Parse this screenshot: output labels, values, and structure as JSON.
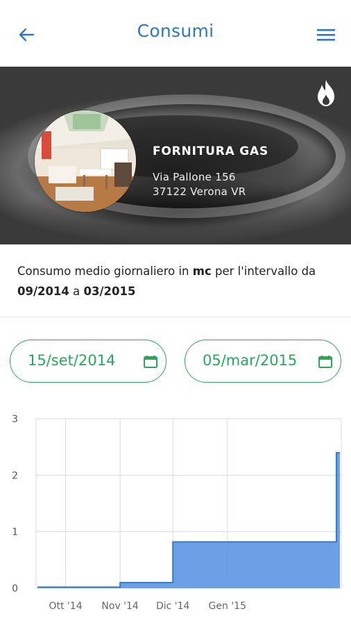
{
  "header": {
    "title": "Consumi",
    "back_icon": "arrow-left-icon",
    "menu_icon": "hamburger-menu-icon",
    "accent": "#2f76c9"
  },
  "hero": {
    "supply_title": "FORNITURA GAS",
    "address_line1": "Via Pallone 156",
    "address_line2": "37122 Verona VR",
    "flame_icon": "flame-icon"
  },
  "description": {
    "prefix": "Consumo medio giornaliero in ",
    "unit": "mc",
    "middle": " per l'intervallo da ",
    "from": "09/2014",
    "connector": " a ",
    "to": "03/2015"
  },
  "date_range": {
    "start": "15/set/2014",
    "end": "05/mar/2015",
    "icon": "calendar-icon",
    "color": "#27a85a"
  },
  "chart_data": {
    "type": "area",
    "x_tick_labels": [
      "Ott '14",
      "Nov '14",
      "Dic '14",
      "Gen '15"
    ],
    "y_tick_labels": [
      "0",
      "1",
      "2",
      "3"
    ],
    "ylim": [
      0,
      3
    ],
    "grid": true,
    "color": "#5b95e3",
    "steps": [
      {
        "from": "15/set/2014",
        "to": "31/ott/2014",
        "value": 0.02
      },
      {
        "from": "01/nov/2014",
        "to": "30/nov/2014",
        "value": 0.1
      },
      {
        "from": "01/dic/2014",
        "to": "03/mar/2015",
        "value": 0.82
      },
      {
        "from": "04/mar/2015",
        "to": "05/mar/2015",
        "value": 2.4
      }
    ]
  }
}
